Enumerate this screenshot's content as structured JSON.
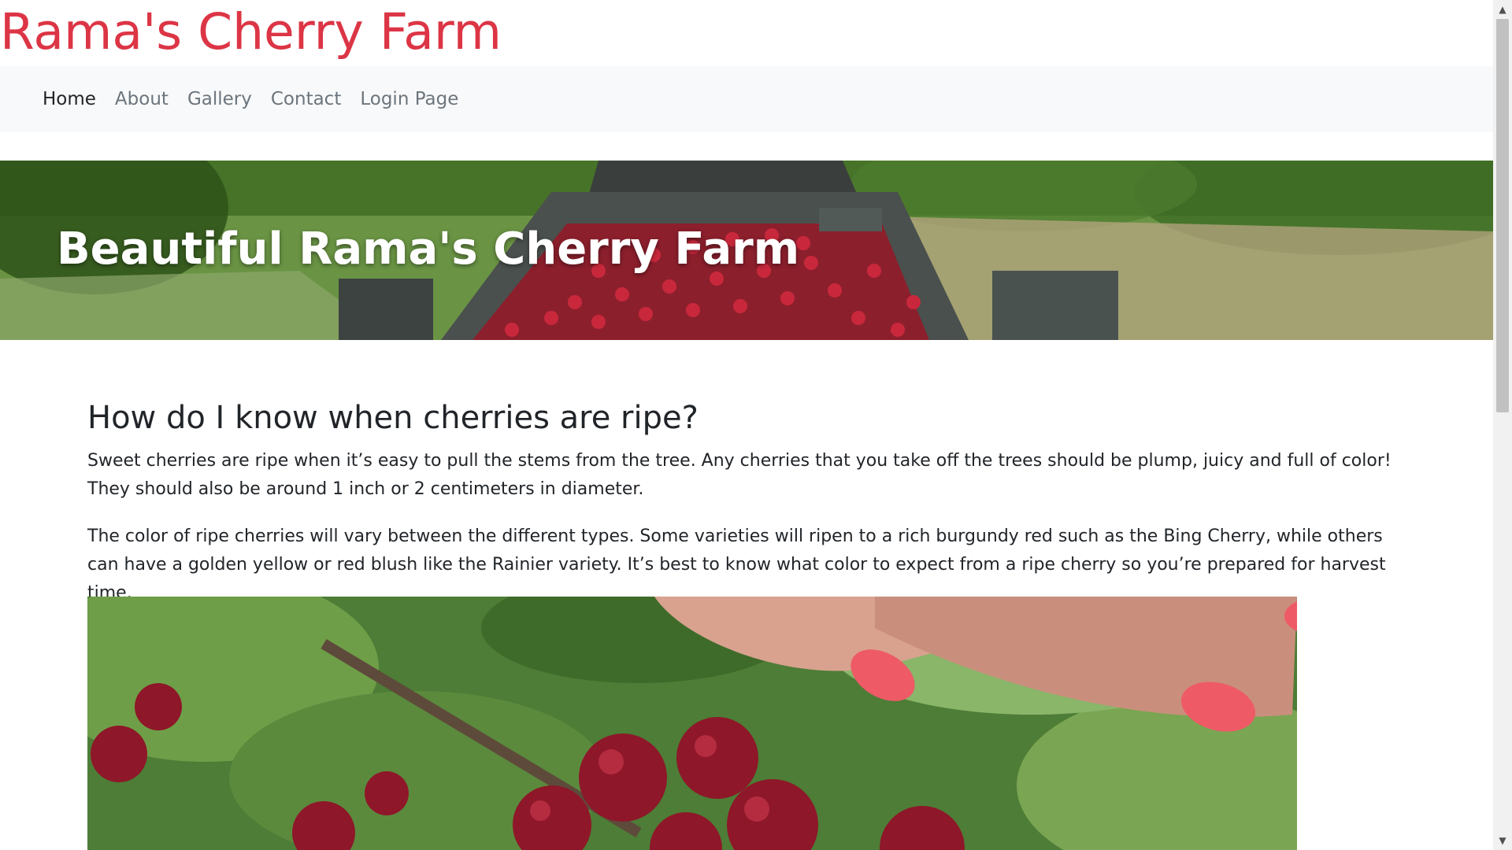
{
  "site": {
    "title": "Rama's Cherry Farm"
  },
  "nav": {
    "items": [
      {
        "label": "Home",
        "active": true
      },
      {
        "label": "About",
        "active": false
      },
      {
        "label": "Gallery",
        "active": false
      },
      {
        "label": "Contact",
        "active": false
      },
      {
        "label": "Login Page",
        "active": false
      }
    ]
  },
  "hero": {
    "title": "Beautiful Rama's Cherry Farm"
  },
  "main": {
    "heading": "How do I know when cherries are ripe?",
    "paragraphs": [
      "Sweet cherries are ripe when it’s easy to pull the stems from the tree. Any cherries that you take off the trees should be plump, juicy and full of color! They should also be around 1 inch or 2 centimeters in diameter.",
      "The color of ripe cherries will vary between the different types. Some varieties will ripen to a rich burgundy red such as the Bing Cherry, while others can have a golden yellow or red blush like the Rainier variety. It’s best to know what color to expect from a ripe cherry so you’re prepared for harvest time."
    ]
  },
  "colors": {
    "brand": "#dc3545",
    "navbar_bg": "#f8f9fa",
    "nav_link": "#6c757d",
    "nav_active": "#212529"
  },
  "icons": {
    "scroll_up": "scroll-up-arrow-icon",
    "scroll_down": "scroll-down-arrow-icon"
  }
}
